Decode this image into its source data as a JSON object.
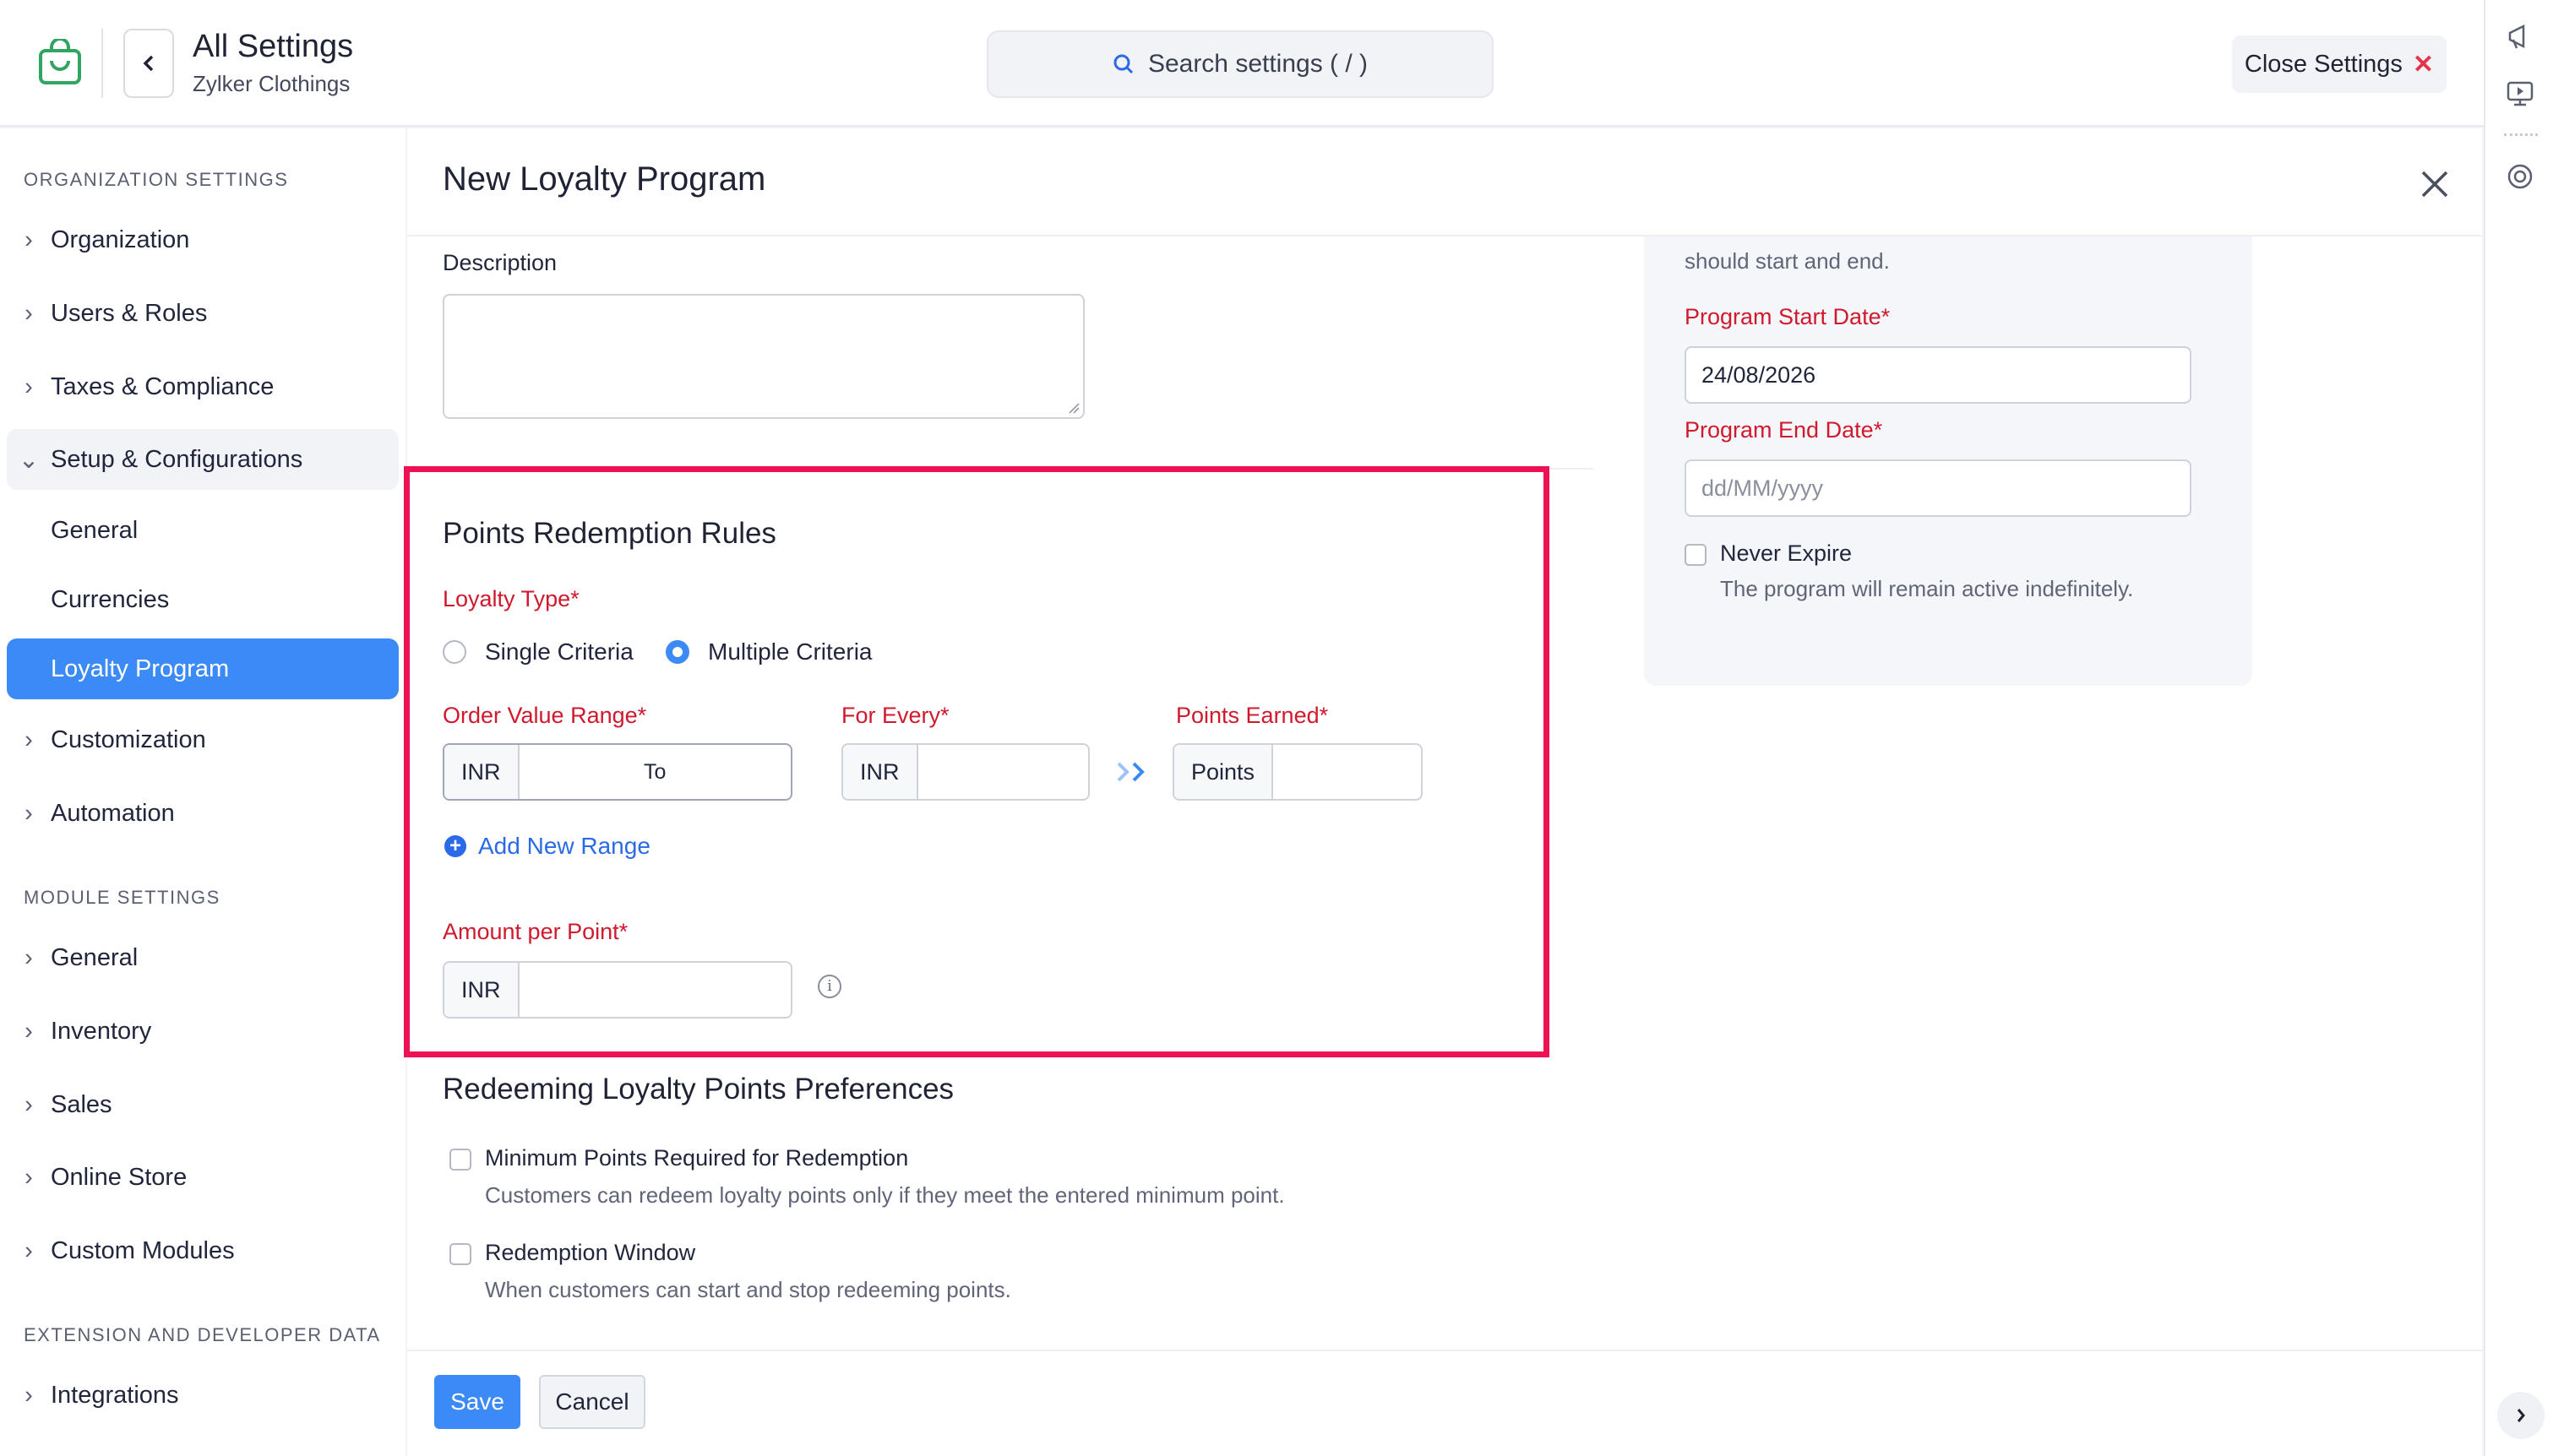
{
  "header": {
    "title": "All Settings",
    "subtitle": "Zylker Clothings",
    "search_placeholder": "Search settings ( / )",
    "close_label": "Close Settings"
  },
  "sidebar": {
    "org_section": "ORGANIZATION SETTINGS",
    "org_items": [
      "Organization",
      "Users & Roles",
      "Taxes & Compliance"
    ],
    "setup_label": "Setup & Configurations",
    "setup_children": [
      "General",
      "Currencies",
      "Loyalty Program"
    ],
    "more_items": [
      "Customization",
      "Automation"
    ],
    "module_section": "MODULE SETTINGS",
    "module_items": [
      "General",
      "Inventory",
      "Sales",
      "Online Store",
      "Custom Modules"
    ],
    "ext_section": "EXTENSION AND DEVELOPER DATA",
    "ext_items": [
      "Integrations"
    ]
  },
  "modal": {
    "title": "New Loyalty Program",
    "description_label": "Description",
    "redemption": {
      "title": "Points Redemption Rules",
      "loyalty_type_label": "Loyalty Type*",
      "options": [
        "Single Criteria",
        "Multiple Criteria"
      ],
      "selected": "Multiple Criteria",
      "order_value_label": "Order Value Range*",
      "for_every_label": "For Every*",
      "points_earned_label": "Points Earned*",
      "currency": "INR",
      "to_label": "To",
      "points_prefix": "Points",
      "add_range": "Add New Range",
      "amount_per_point_label": "Amount per Point*",
      "info_glyph": "i"
    },
    "preferences": {
      "title": "Redeeming Loyalty Points Preferences",
      "min_points_label": "Minimum Points Required for Redemption",
      "min_points_help": "Customers can redeem loyalty points only if they meet the entered minimum point.",
      "window_label": "Redemption Window",
      "window_help": "When customers can start and stop redeeming points."
    },
    "duration": {
      "partial_text": "should start and end.",
      "start_label": "Program Start Date*",
      "start_value": "24/08/2026",
      "end_label": "Program End Date*",
      "end_placeholder": "dd/MM/yyyy",
      "never_expire_label": "Never Expire",
      "never_expire_help": "The program will remain active indefinitely."
    },
    "footer": {
      "save": "Save",
      "cancel": "Cancel"
    }
  },
  "colors": {
    "accent": "#3b8af5",
    "required": "#d0192d",
    "highlight_box": "#ee1254",
    "link": "#2a6ae8"
  }
}
